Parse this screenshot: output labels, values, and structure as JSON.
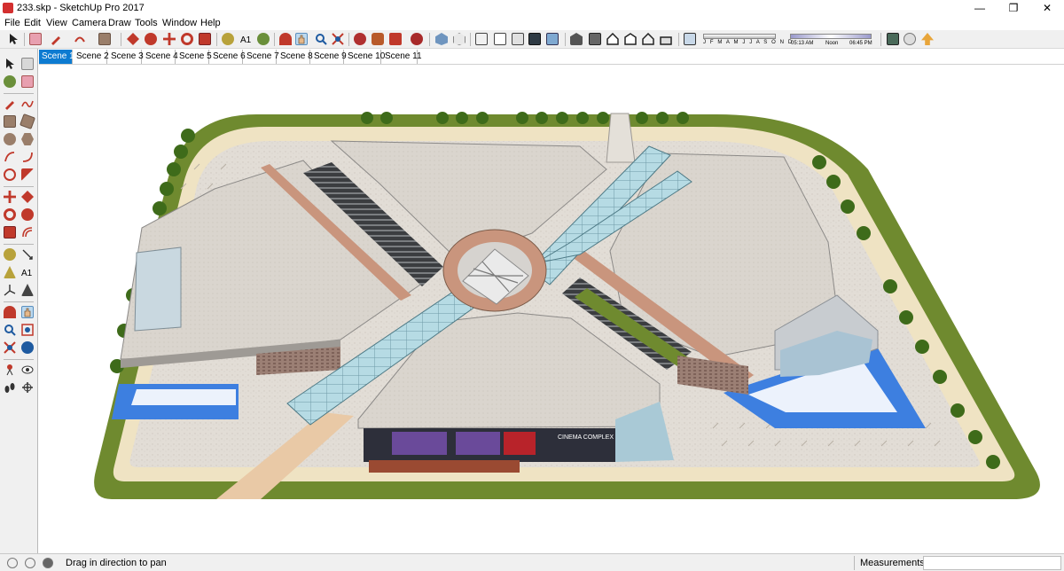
{
  "window": {
    "title": "233.skp - SketchUp Pro 2017",
    "minimize": "—",
    "maximize": "❐",
    "close": "✕"
  },
  "menu": [
    "File",
    "Edit",
    "View",
    "Camera",
    "Draw",
    "Tools",
    "Window",
    "Help"
  ],
  "shadow": {
    "months": "J F M A M J J A S O N D",
    "time_start": "05:13 AM",
    "time_mid": "Noon",
    "time_end": "06:45 PM"
  },
  "scenes": {
    "active": "Scene 1",
    "tabs": [
      "Scene 1",
      "Scene 2",
      "Scene 3",
      "Scene 4",
      "Scene 5",
      "Scene 6",
      "Scene 7",
      "Scene 8",
      "Scene 9",
      "Scene 10",
      "Scene 11"
    ]
  },
  "status": {
    "hint": "Drag in direction to pan",
    "measurements_label": "Measurements",
    "measurements_value": ""
  },
  "colors": {
    "grass": "#6f8a2f",
    "path": "#efd9b5",
    "paving": "#e2ddd6",
    "roof": "#dcd7d0",
    "glass": "#a9d1db",
    "water": "#3d7fe0",
    "terracotta": "#c9957d",
    "tree": "#3e6b1a",
    "accent": "#0d7bd1"
  }
}
